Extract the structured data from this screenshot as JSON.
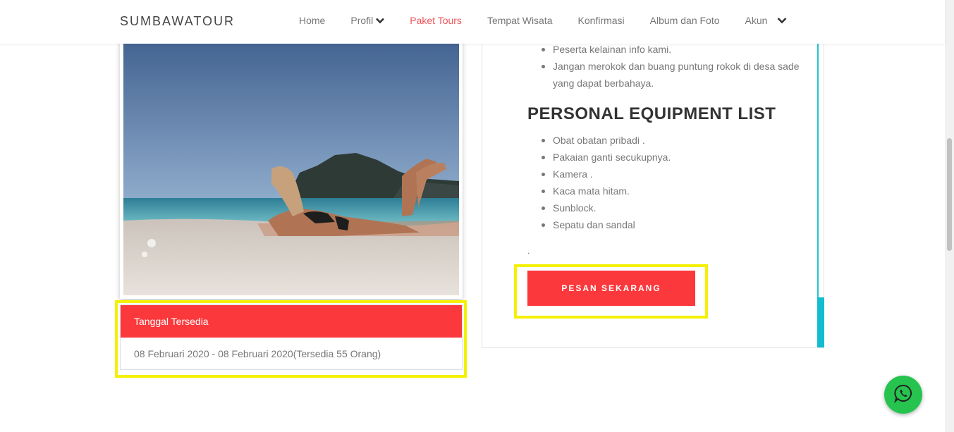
{
  "brand": "SUMBAWATOUR",
  "nav": [
    {
      "label": "Home"
    },
    {
      "label": "Profil"
    },
    {
      "label": "Paket Tours"
    },
    {
      "label": "Tempat Wisata"
    },
    {
      "label": "Konfirmasi"
    },
    {
      "label": "Album dan Foto"
    },
    {
      "label": "Akun"
    }
  ],
  "colors": {
    "accent": "#fb383b",
    "active_nav": "#f0555a",
    "highlight": "#f4f000",
    "teal": "#13bcd0",
    "whatsapp": "#26c44f"
  },
  "photo": {
    "icon": "beach-photo"
  },
  "dates": {
    "header": "Tanggal Tersedia",
    "entry": "08 Februari 2020 - 08 Februari 2020(Tersedia 55 Orang)"
  },
  "rules": [
    "Peserta kelainan info kami.",
    "Jangan merokok dan buang puntung rokok di desa sade yang dapat berbahaya."
  ],
  "equipment": {
    "title": "PERSONAL EQUIPMENT LIST",
    "items": [
      "Obat obatan pribadi .",
      "Pakaian ganti secukupnya.",
      "Kamera .",
      "Kaca mata hitam.",
      "Sunblock.",
      "Sepatu dan sandal"
    ],
    "trailing": "."
  },
  "book_button": "PESAN SEKARANG",
  "whatsapp_icon": "whatsapp-icon"
}
